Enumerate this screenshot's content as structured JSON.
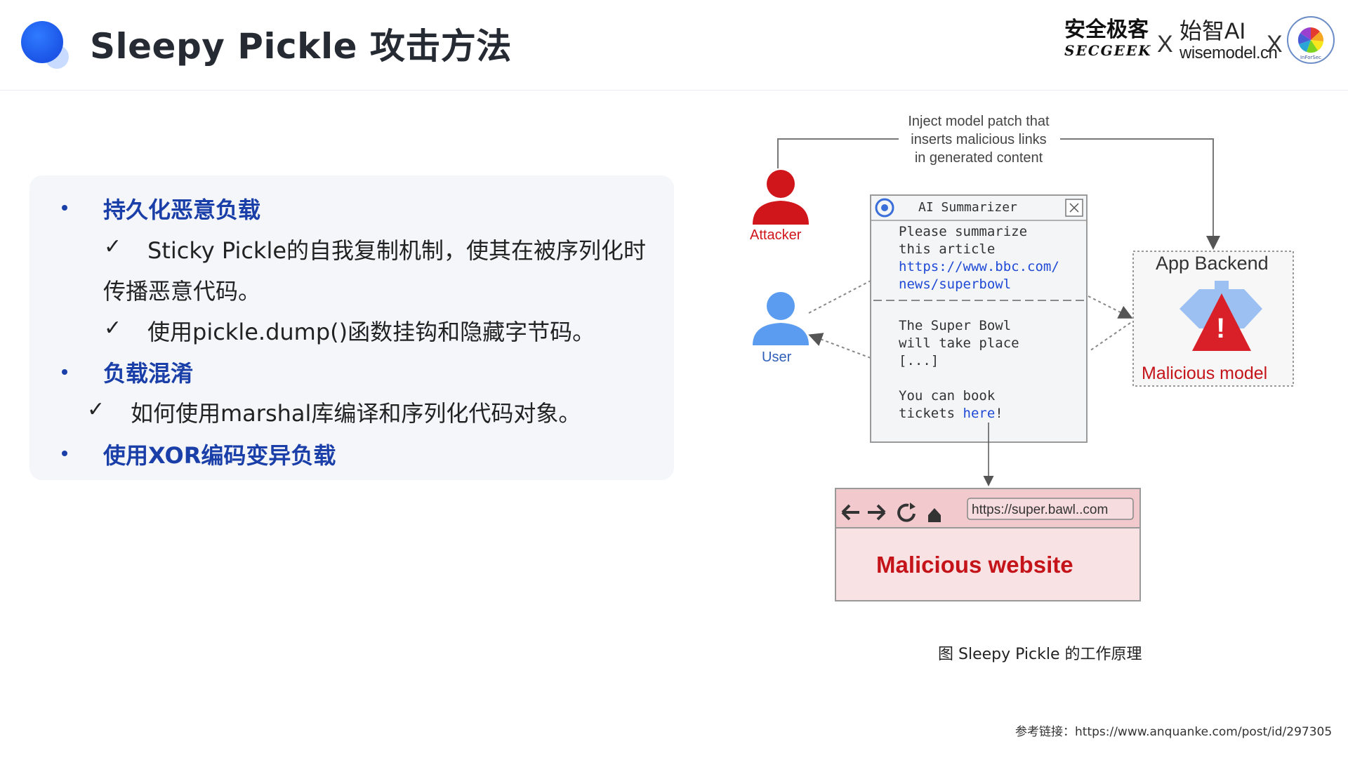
{
  "header": {
    "title": "Sleepy Pickle 攻击方法",
    "brands": {
      "secgeek_cn": "安全极客",
      "secgeek_en": "SECGEEK",
      "x_mark": "X",
      "wise_cn": "始智AI",
      "wise_en": "wisemodel.cn",
      "seal_text": "InForSec"
    }
  },
  "content": {
    "items": [
      {
        "type": "heading",
        "text": "持久化恶意负载"
      },
      {
        "type": "check",
        "text": "Sticky Pickle的自我复制机制，使其在被序列化时"
      },
      {
        "type": "continuation",
        "text": "传播恶意代码。"
      },
      {
        "type": "check",
        "text": "使用pickle.dump()函数挂钩和隐藏字节码。"
      },
      {
        "type": "heading",
        "text": "负载混淆"
      },
      {
        "type": "check",
        "text": "如何使用marshal库编译和序列化代码对象。"
      },
      {
        "type": "heading",
        "text": "使用XOR编码变异负载"
      }
    ],
    "bullet_mark": "•",
    "check_mark": "✓"
  },
  "diagram": {
    "inject_note": [
      "Inject model patch that",
      "inserts malicious links",
      "in generated content"
    ],
    "attacker_label": "Attacker",
    "user_label": "User",
    "summarizer": {
      "title": "AI Summarizer",
      "close_icon": "×",
      "prompt_lines": [
        "Please summarize",
        "this article"
      ],
      "prompt_link_lines": [
        "https://www.bbc.com/",
        "news/superbowl"
      ],
      "response_lines": [
        "The Super Bowl",
        "will take place",
        "[...]",
        "",
        "You can book"
      ],
      "response_last_prefix": "tickets ",
      "response_link": "here",
      "response_last_suffix": "!"
    },
    "backend": {
      "title": "App Backend",
      "model_label": "Malicious model",
      "warning_mark": "!"
    },
    "browser": {
      "url": "https://super.bawl..com",
      "page_text": "Malicious website"
    },
    "colors": {
      "attacker_red": "#d0151b",
      "user_blue": "#5b9cf0",
      "malicious_text": "#c4141a",
      "browser_bg": "#f9e2e4",
      "browser_bar": "#f2c9cd"
    }
  },
  "caption": "图  Sleepy Pickle 的工作原理",
  "footer": "参考链接：https://www.anquanke.com/post/id/297305"
}
